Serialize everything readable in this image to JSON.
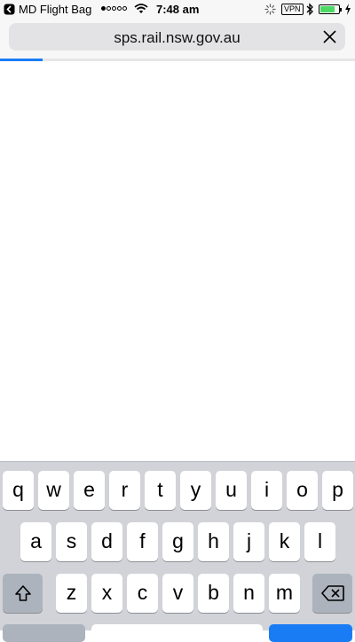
{
  "status_bar": {
    "back_app": "MD Flight Bag",
    "signal_dots_filled": 1,
    "signal_dots_total": 5,
    "time": "7:48 am",
    "vpn_label": "VPN",
    "battery_level": 0.8,
    "battery_color": "#4cd964",
    "icons": [
      "back-arrow-icon",
      "wifi-icon",
      "activity-spinner-icon",
      "bluetooth-icon",
      "battery-icon",
      "charging-bolt-icon"
    ]
  },
  "url_bar": {
    "url": "sps.rail.nsw.gov.au",
    "stop_icon": "close-icon",
    "loading_progress": 0.12,
    "progress_color": "#1a7cf4"
  },
  "keyboard": {
    "row1": [
      "q",
      "w",
      "e",
      "r",
      "t",
      "y",
      "u",
      "i",
      "o",
      "p"
    ],
    "row2": [
      "a",
      "s",
      "d",
      "f",
      "g",
      "h",
      "j",
      "k",
      "l"
    ],
    "row3": [
      "z",
      "x",
      "c",
      "v",
      "b",
      "n",
      "m"
    ],
    "shift_icon": "shift-icon",
    "delete_icon": "backspace-icon"
  }
}
